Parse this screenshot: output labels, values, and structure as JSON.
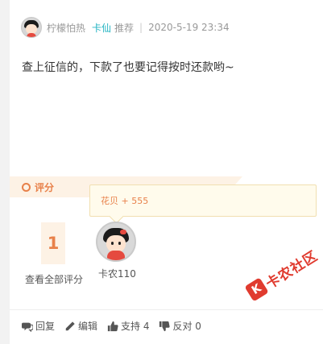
{
  "post": {
    "author": "柠檬怕热",
    "tag": "卡仙",
    "recommend": "推荐",
    "separator": "|",
    "datetime": "2020-5-19 23:34",
    "body": "查上征信的，下款了也要记得按时还款哟~"
  },
  "rating": {
    "title": "评分",
    "tooltip": "花贝 + 555",
    "score": "1",
    "view_all": "查看全部评分",
    "rater_name": "卡农110"
  },
  "actions": {
    "reply": "回复",
    "edit": "编辑",
    "support": "支持 4",
    "oppose": "反对 0"
  },
  "watermark": {
    "logo": "K",
    "text": "卡农社区"
  },
  "colors": {
    "accent_orange": "#e8814a",
    "tag_cyan": "#22b3c2",
    "watermark_red": "#e03b2f"
  }
}
